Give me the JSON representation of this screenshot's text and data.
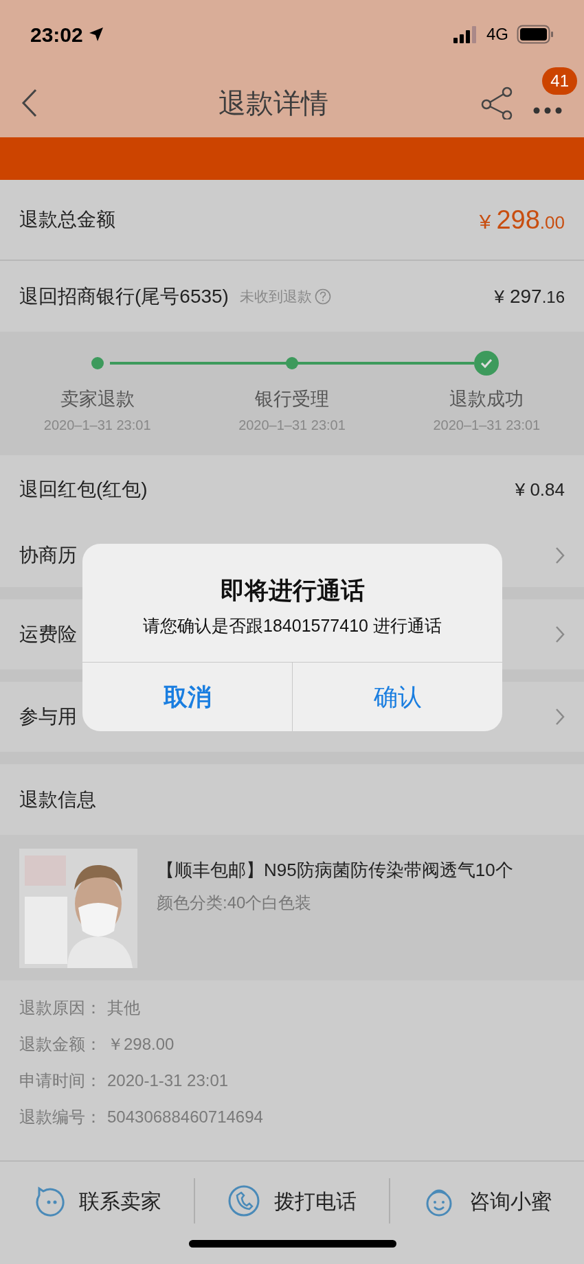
{
  "status_bar": {
    "time": "23:02",
    "network": "4G"
  },
  "nav": {
    "title": "退款详情",
    "badge": "41"
  },
  "total": {
    "label": "退款总金额",
    "currency": "¥",
    "amount": "298",
    "decimals": ".00"
  },
  "bank": {
    "label": "退回招商银行(尾号6535)",
    "hint": "未收到退款",
    "currency": "¥",
    "amount": "297",
    "decimals": ".16"
  },
  "steps": [
    {
      "label": "卖家退款",
      "date": "2020–1–31 23:01",
      "done": true,
      "current": false
    },
    {
      "label": "银行受理",
      "date": "2020–1–31 23:01",
      "done": true,
      "current": false
    },
    {
      "label": "退款成功",
      "date": "2020–1–31 23:01",
      "done": true,
      "current": true
    }
  ],
  "red_packet": {
    "label": "退回红包(红包)",
    "amount": "¥ 0.84"
  },
  "link_rows": [
    {
      "label": "协商历"
    },
    {
      "label": "运费险"
    },
    {
      "label": "参与用"
    }
  ],
  "section_title": "退款信息",
  "product": {
    "kind": "picture",
    "title": "【顺丰包邮】N95防病菌防传染带阀透气10个",
    "variant": "颜色分类:40个白色装"
  },
  "info": [
    {
      "label": "退款原因：",
      "value": "其他"
    },
    {
      "label": "退款金额：",
      "value": "￥298.00"
    },
    {
      "label": "申请时间：",
      "value": "2020-1-31 23:01"
    },
    {
      "label": "退款编号：",
      "value": "50430688460714694"
    }
  ],
  "bottom_bar": [
    {
      "kind": "chat",
      "label": "联系卖家"
    },
    {
      "kind": "phone",
      "label": "拨打电话"
    },
    {
      "kind": "bee",
      "label": "咨询小蜜"
    }
  ],
  "dialog": {
    "title": "即将进行通话",
    "message": "请您确认是否跟18401577410 进行通话",
    "buttons": [
      {
        "label": "取消",
        "bold": true
      },
      {
        "label": "确认",
        "bold": false
      }
    ]
  }
}
